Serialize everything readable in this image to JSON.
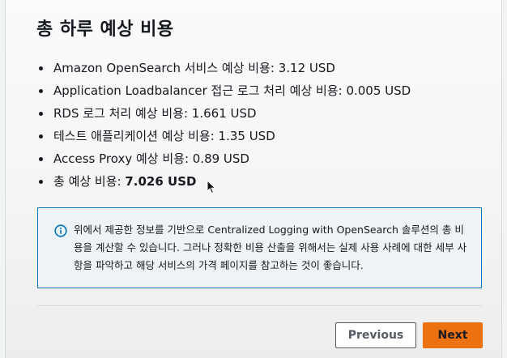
{
  "title": "총 하루 예상 비용",
  "cost_items": [
    {
      "label": "Amazon OpenSearch 서비스 예상 비용: ",
      "value": "3.12 USD"
    },
    {
      "label": "Application Loadbalancer 접근 로그 처리 예상 비용: ",
      "value": "0.005 USD"
    },
    {
      "label": "RDS 로그 처리 예상 비용: ",
      "value": "1.661 USD"
    },
    {
      "label": "테스트 애플리케이션 예상 비용: ",
      "value": "1.35 USD"
    },
    {
      "label": "Access Proxy 예상 비용: ",
      "value": "0.89 USD"
    },
    {
      "label": "총 예상 비용: ",
      "value": "7.026 USD"
    }
  ],
  "info": {
    "icon": "info-circle-icon",
    "text": "위에서 제공한 정보를 기반으로 Centralized Logging with OpenSearch 솔루션의 총 비용을 계산할 수 있습니다. 그러나 정확한 비용 산출을 위해서는 실제 사용 사례에 대한 세부 사항을 파악하고 해당 서비스의 가격 페이지를 참고하는 것이 좋습니다.",
    "border_color": "#0073bb",
    "background_color": "#eef4f6"
  },
  "buttons": {
    "previous_label": "Previous",
    "next_label": "Next",
    "next_color": "#ec7211"
  }
}
